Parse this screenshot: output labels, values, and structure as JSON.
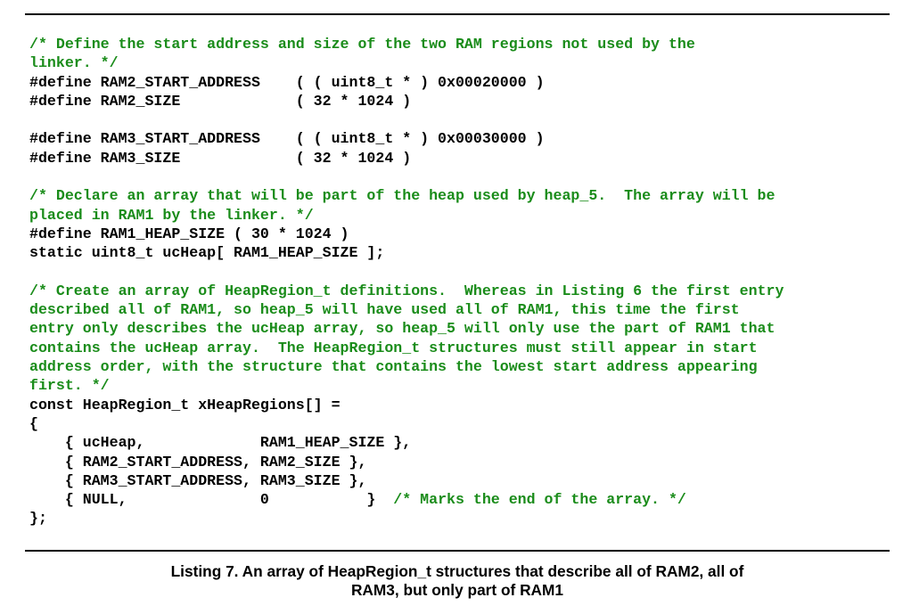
{
  "code_lines": [
    {
      "text": "/* Define the start address and size of the two RAM regions not used by the",
      "kind": "comment"
    },
    {
      "text": "linker. */",
      "kind": "comment"
    },
    {
      "text": "#define RAM2_START_ADDRESS    ( ( uint8_t * ) 0x00020000 )",
      "kind": "code"
    },
    {
      "text": "#define RAM2_SIZE             ( 32 * 1024 )",
      "kind": "code"
    },
    {
      "text": "",
      "kind": "blank"
    },
    {
      "text": "#define RAM3_START_ADDRESS    ( ( uint8_t * ) 0x00030000 )",
      "kind": "code"
    },
    {
      "text": "#define RAM3_SIZE             ( 32 * 1024 )",
      "kind": "code"
    },
    {
      "text": "",
      "kind": "blank"
    },
    {
      "text": "/* Declare an array that will be part of the heap used by heap_5.  The array will be",
      "kind": "comment"
    },
    {
      "text": "placed in RAM1 by the linker. */",
      "kind": "comment"
    },
    {
      "text": "#define RAM1_HEAP_SIZE ( 30 * 1024 )",
      "kind": "code"
    },
    {
      "text": "static uint8_t ucHeap[ RAM1_HEAP_SIZE ];",
      "kind": "code"
    },
    {
      "text": "",
      "kind": "blank"
    },
    {
      "text": "/* Create an array of HeapRegion_t definitions.  Whereas in Listing 6 the first entry",
      "kind": "comment"
    },
    {
      "text": "described all of RAM1, so heap_5 will have used all of RAM1, this time the first",
      "kind": "comment"
    },
    {
      "text": "entry only describes the ucHeap array, so heap_5 will only use the part of RAM1 that",
      "kind": "comment"
    },
    {
      "text": "contains the ucHeap array.  The HeapRegion_t structures must still appear in start",
      "kind": "comment"
    },
    {
      "text": "address order, with the structure that contains the lowest start address appearing",
      "kind": "comment"
    },
    {
      "text": "first. */",
      "kind": "comment"
    },
    {
      "text": "const HeapRegion_t xHeapRegions[] =",
      "kind": "code"
    },
    {
      "text": "{",
      "kind": "code"
    },
    {
      "text": "    { ucHeap,             RAM1_HEAP_SIZE },",
      "kind": "code"
    },
    {
      "text": "    { RAM2_START_ADDRESS, RAM2_SIZE },",
      "kind": "code"
    },
    {
      "text": "    { RAM3_START_ADDRESS, RAM3_SIZE },",
      "kind": "code"
    },
    {
      "text": "    { NULL,               0           }",
      "kind": "code",
      "trailing_comment": "  /* Marks the end of the array. */"
    },
    {
      "text": "};",
      "kind": "code"
    }
  ],
  "caption": {
    "line1": "Listing 7. An array of HeapRegion_t structures that describe all of RAM2, all of",
    "line2": "RAM3, but only part of RAM1"
  }
}
